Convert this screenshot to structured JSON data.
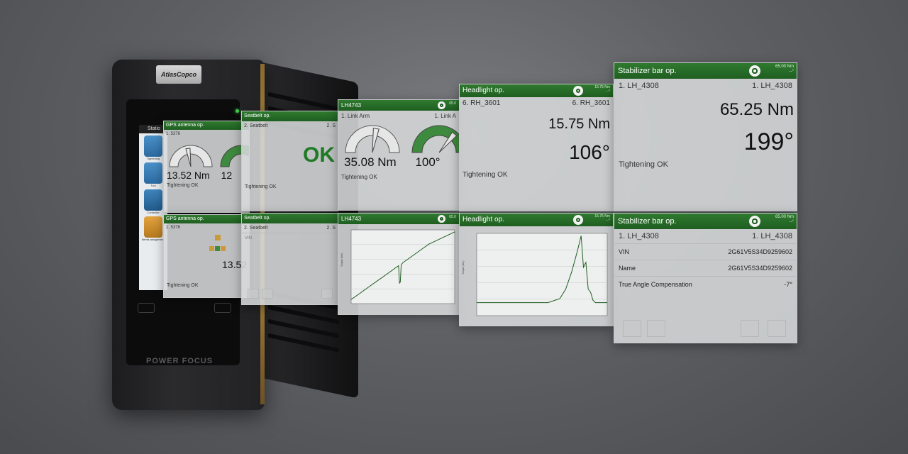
{
  "device": {
    "logo": "AtlasCopco",
    "brand": "POWER FOCUS",
    "screen_header": "Statio",
    "tiles": [
      {
        "label": "Tightening",
        "icon": "bolt-icon"
      },
      {
        "label": "Tool",
        "icon": "wrench-tool-icon"
      },
      {
        "label": "Controller",
        "icon": "controller-icon"
      },
      {
        "label": "Itemis assignment",
        "icon": "barcode-icon"
      }
    ]
  },
  "panels": {
    "gps_top": {
      "title": "GPS antenna op.",
      "row_left": "1. 5376",
      "torque": "13.52 Nm",
      "angle_partial": "12",
      "status": "Tightening OK"
    },
    "gps_bottom": {
      "title": "GPS antenna op.",
      "row_left": "1. 5376",
      "torque_partial": "13.52",
      "status": "Tightening OK"
    },
    "seatbelt_top": {
      "title": "Seatbelt op.",
      "row_left": "2. Seatbelt",
      "row_right": "2. S",
      "result": "OK",
      "status": "Tightening OK"
    },
    "seatbelt_bottom": {
      "title": "Seatbelt op.",
      "row_left": "2. Seatbelt",
      "row_right": "2. S",
      "field": "VIN"
    },
    "lh4743_top": {
      "title": "LH4743",
      "meta": "65.0",
      "row_left": "1. Link Arm",
      "row_right": "1. Link A",
      "torque": "35.08 Nm",
      "angle": "100°",
      "status": "Tightening OK"
    },
    "lh4743_bottom": {
      "title": "LH4743",
      "meta": "65.0"
    },
    "headlight_top": {
      "title": "Headlight op.",
      "meta1": "15.75 Nm",
      "meta2": "--°",
      "row_left": "6. RH_3601",
      "row_right": "6. RH_3601",
      "torque": "15.75 Nm",
      "angle": "106°",
      "status": "Tightening OK"
    },
    "headlight_bottom": {
      "title": "Headlight op.",
      "meta1": "15.75 Nm",
      "meta2": "--°"
    },
    "stabilizer_top": {
      "title": "Stabilizer bar op.",
      "meta1": "65.00 Nm",
      "meta2": "--°",
      "row_left": "1. LH_4308",
      "row_right": "1. LH_4308",
      "torque": "65.25 Nm",
      "angle": "199°",
      "status": "Tightening OK"
    },
    "stabilizer_bottom": {
      "title": "Stabilizer bar op.",
      "meta1": "65.00 Nm",
      "meta2": "--°",
      "row_left": "1. LH_4308",
      "row_right": "1. LH_4308",
      "fields": [
        {
          "label": "VIN",
          "value": "2G61V5S34D9259602"
        },
        {
          "label": "Name",
          "value": "2G61V5S34D9259602"
        },
        {
          "label": "True Angle Compensation",
          "value": "-7°"
        }
      ]
    }
  },
  "gauges": {
    "gps_torque": 0.45,
    "gps_angle": 0.6,
    "lh_torque": 0.55,
    "lh_angle": 0.72
  },
  "chart_data": [
    {
      "type": "line",
      "title": "",
      "panel": "LH4743",
      "xlabel": "",
      "ylabel": "Torque (Nm)",
      "x": [
        0,
        10,
        20,
        30,
        40,
        50,
        55,
        56,
        57,
        58,
        60,
        70,
        80,
        90,
        100,
        110,
        120
      ],
      "y": [
        2,
        5,
        8,
        11,
        14,
        17,
        18.5,
        10,
        10.5,
        19,
        20,
        23,
        26,
        29,
        31,
        33,
        35
      ],
      "xlim": [
        0,
        120
      ],
      "ylim": [
        0,
        36
      ],
      "grid": true
    },
    {
      "type": "line",
      "title": "",
      "panel": "Headlight op.",
      "xlabel": "",
      "ylabel": "Torque (Nm)",
      "x": [
        0,
        200,
        400,
        600,
        700,
        750,
        800,
        850,
        880,
        900,
        920,
        940,
        960,
        980,
        1000,
        1100
      ],
      "y": [
        2.7,
        2.7,
        2.7,
        2.7,
        3.5,
        5.5,
        9,
        13.5,
        16.5,
        10,
        11,
        5.5,
        4.8,
        3.2,
        2.7,
        2.7
      ],
      "xlim": [
        0,
        1100
      ],
      "ylim": [
        0,
        17
      ],
      "grid": true
    }
  ],
  "colors": {
    "header_green": "#256b27",
    "ok_green": "#1e7a24",
    "background": "#5f6064"
  }
}
